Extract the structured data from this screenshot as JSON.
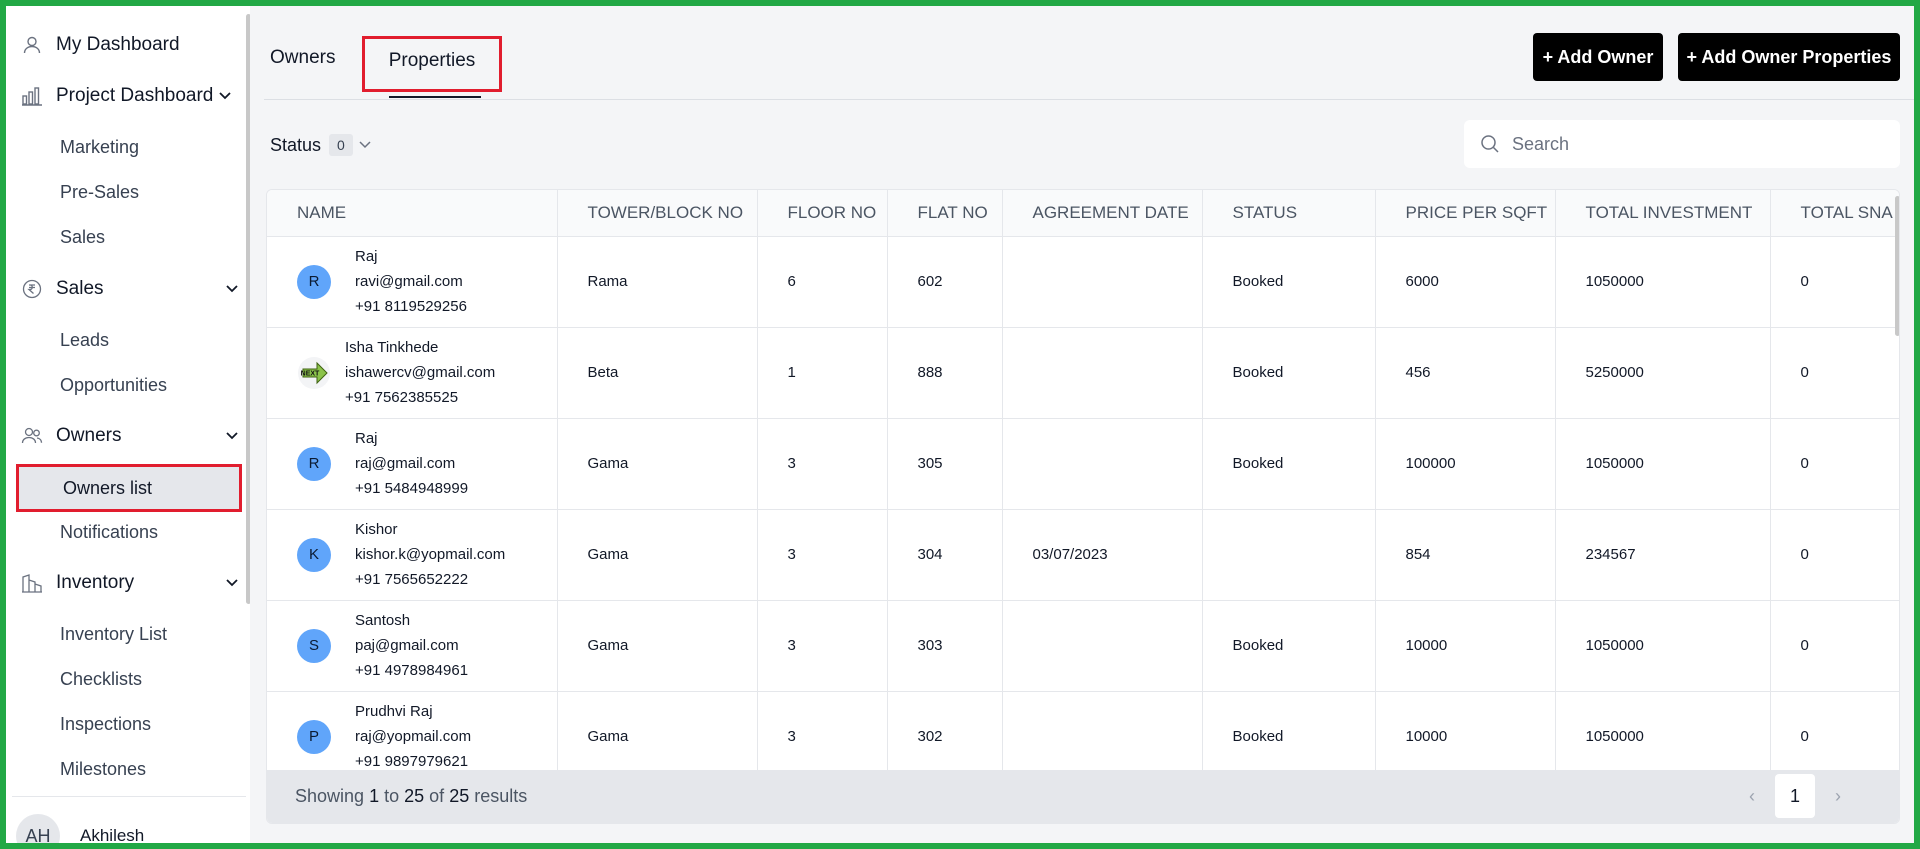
{
  "sidebar": {
    "my_dashboard": "My Dashboard",
    "project_dashboard": "Project Dashboard",
    "project_items": [
      "Marketing",
      "Pre-Sales",
      "Sales"
    ],
    "sales": "Sales",
    "sales_items": [
      "Leads",
      "Opportunities"
    ],
    "owners": "Owners",
    "owners_items": [
      "Owners list",
      "Notifications"
    ],
    "inventory": "Inventory",
    "inventory_items": [
      "Inventory List",
      "Checklists",
      "Inspections",
      "Milestones"
    ],
    "user": {
      "initials": "AH",
      "name": "Akhilesh"
    }
  },
  "tabs": {
    "owners": "Owners",
    "properties": "Properties"
  },
  "actions": {
    "add_owner": "+ Add Owner",
    "add_owner_properties": "+ Add Owner Properties"
  },
  "filter": {
    "label": "Status",
    "count": "0"
  },
  "search": {
    "placeholder": "Search"
  },
  "table": {
    "columns": [
      "NAME",
      "TOWER/BLOCK NO",
      "FLOOR NO",
      "FLAT NO",
      "AGREEMENT DATE",
      "STATUS",
      "PRICE PER SQFT",
      "TOTAL INVESTMENT",
      "TOTAL SNA"
    ],
    "rows": [
      {
        "avatar": "R",
        "name": "Raj",
        "email": "ravi@gmail.com",
        "phone": "+91 8119529256",
        "tower": "Rama",
        "floor": "6",
        "flat": "602",
        "agreement": "",
        "status": "Booked",
        "price": "6000",
        "investment": "1050000",
        "sna": "0"
      },
      {
        "avatar": "NEXT",
        "name": "Isha Tinkhede",
        "email": "ishawercv@gmail.com",
        "phone": "+91 7562385525",
        "tower": "Beta",
        "floor": "1",
        "flat": "888",
        "agreement": "",
        "status": "Booked",
        "price": "456",
        "investment": "5250000",
        "sna": "0"
      },
      {
        "avatar": "R",
        "name": "Raj",
        "email": "raj@gmail.com",
        "phone": "+91 5484948999",
        "tower": "Gama",
        "floor": "3",
        "flat": "305",
        "agreement": "",
        "status": "Booked",
        "price": "100000",
        "investment": "1050000",
        "sna": "0"
      },
      {
        "avatar": "K",
        "name": "Kishor",
        "email": "kishor.k@yopmail.com",
        "phone": "+91 7565652222",
        "tower": "Gama",
        "floor": "3",
        "flat": "304",
        "agreement": "03/07/2023",
        "status": "",
        "price": "854",
        "investment": "234567",
        "sna": "0"
      },
      {
        "avatar": "S",
        "name": "Santosh",
        "email": "paj@gmail.com",
        "phone": "+91 4978984961",
        "tower": "Gama",
        "floor": "3",
        "flat": "303",
        "agreement": "",
        "status": "Booked",
        "price": "10000",
        "investment": "1050000",
        "sna": "0"
      },
      {
        "avatar": "P",
        "name": "Prudhvi Raj",
        "email": "raj@yopmail.com",
        "phone": "+91 9897979621",
        "tower": "Gama",
        "floor": "3",
        "flat": "302",
        "agreement": "",
        "status": "Booked",
        "price": "10000",
        "investment": "1050000",
        "sna": "0"
      }
    ]
  },
  "footer": {
    "showing": "Showing",
    "from": "1",
    "to_word": "to",
    "to": "25",
    "of_word": "of",
    "total": "25",
    "results": "results",
    "page": "1",
    "prev": "‹",
    "next": "›"
  }
}
